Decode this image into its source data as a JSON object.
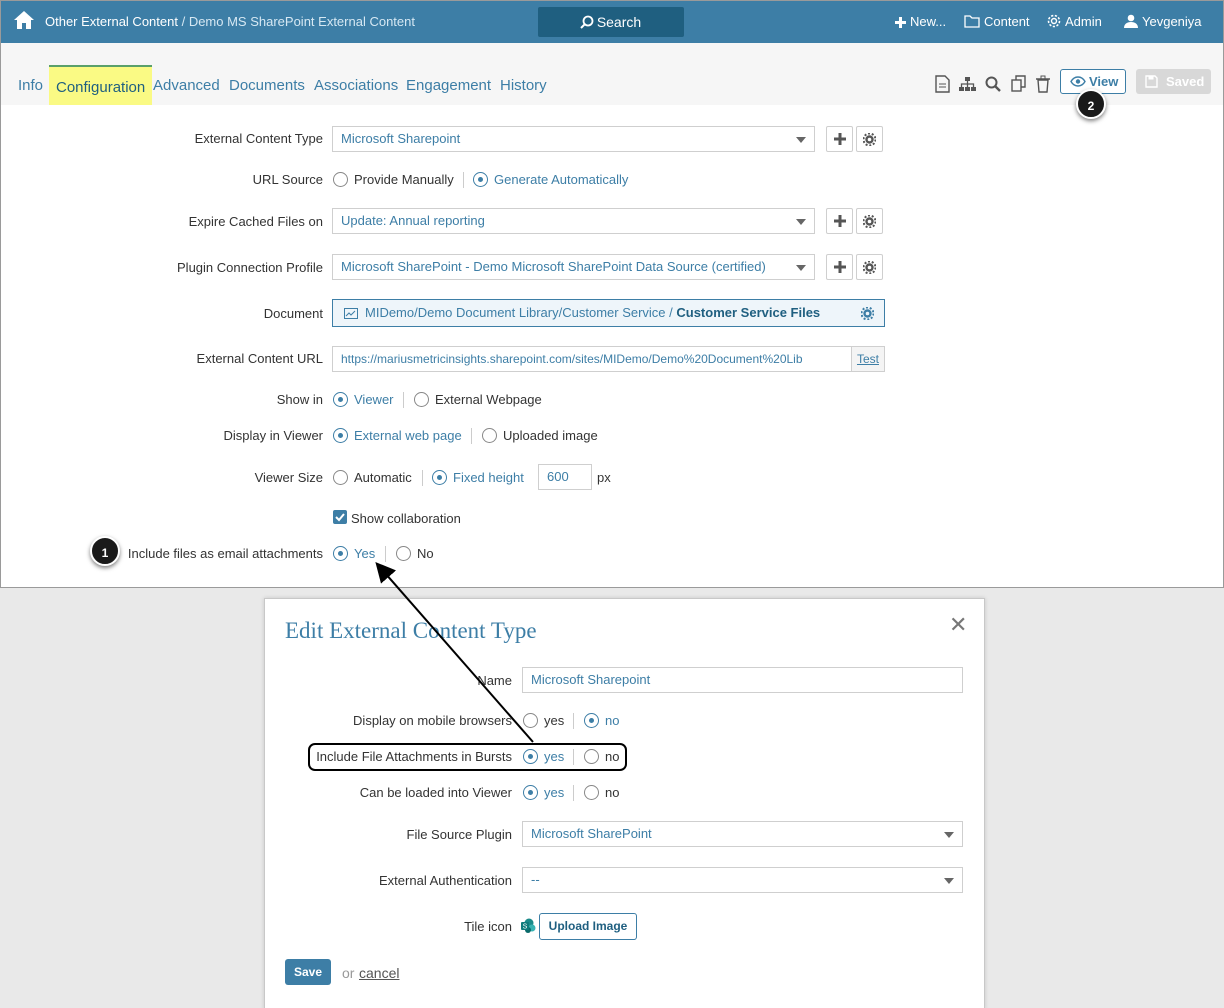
{
  "header": {
    "crumb_root": "Other External Content",
    "crumb_sep": " / ",
    "crumb_page": "Demo MS SharePoint External Content",
    "search_label": "Search",
    "nav": {
      "new": "New...",
      "content": "Content",
      "admin": "Admin",
      "user": "Yevgeniya"
    }
  },
  "tabs": [
    "Info",
    "Configuration",
    "Advanced",
    "Documents",
    "Associations",
    "Engagement",
    "History"
  ],
  "toolbar": {
    "view_label": "View",
    "saved_label": "Saved"
  },
  "markers": {
    "m1": "1",
    "m2": "2"
  },
  "form": {
    "content_type": {
      "label": "External Content Type",
      "value": "Microsoft Sharepoint"
    },
    "url_source": {
      "label": "URL Source",
      "opt1": "Provide Manually",
      "opt2": "Generate Automatically"
    },
    "expire": {
      "label": "Expire Cached Files on",
      "value": "Update: Annual reporting"
    },
    "plugin": {
      "label": "Plugin Connection Profile",
      "value": "Microsoft SharePoint - Demo Microsoft SharePoint Data Source (certified)"
    },
    "document": {
      "label": "Document",
      "path": "MIDemo/Demo Document Library/Customer Service / ",
      "name": "Customer Service Files"
    },
    "url": {
      "label": "External Content URL",
      "value": "https://mariusmetricinsights.sharepoint.com/sites/MIDemo/Demo%20Document%20Lib",
      "test": "Test"
    },
    "show_in": {
      "label": "Show in",
      "opt1": "Viewer",
      "opt2": "External Webpage"
    },
    "display": {
      "label": "Display in Viewer",
      "opt1": "External web page",
      "opt2": "Uploaded image"
    },
    "viewer_size": {
      "label": "Viewer Size",
      "opt1": "Automatic",
      "opt2": "Fixed height",
      "value": "600",
      "unit": "px"
    },
    "collab": {
      "label": "Show collaboration"
    },
    "email": {
      "label": "Include files as email attachments",
      "opt1": "Yes",
      "opt2": "No"
    }
  },
  "modal": {
    "title": "Edit External Content Type",
    "name": {
      "label": "Name",
      "value": "Microsoft Sharepoint"
    },
    "mobile": {
      "label": "Display on mobile browsers",
      "yes": "yes",
      "no": "no"
    },
    "bursts": {
      "label": "Include File Attachments in Bursts",
      "yes": "yes",
      "no": "no"
    },
    "viewer": {
      "label": "Can be loaded into Viewer",
      "yes": "yes",
      "no": "no"
    },
    "plugin": {
      "label": "File Source Plugin",
      "value": "Microsoft SharePoint"
    },
    "auth": {
      "label": "External Authentication",
      "value": "--"
    },
    "tile": {
      "label": "Tile icon",
      "button": "Upload Image"
    },
    "save": "Save",
    "or": "or",
    "cancel": "cancel"
  }
}
